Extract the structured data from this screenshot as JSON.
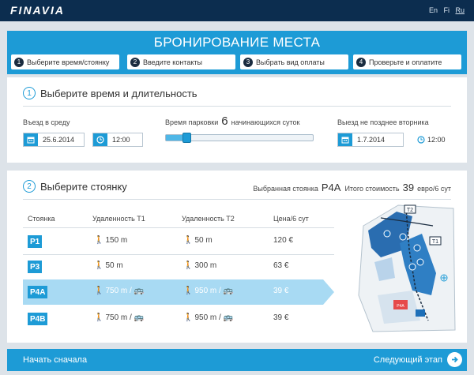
{
  "header": {
    "logo": "FINAVIA",
    "languages": [
      "En",
      "Fi",
      "Ru"
    ],
    "active_language": "Ru"
  },
  "booking": {
    "title": "БРОНИРОВАНИЕ МЕСТА",
    "steps": [
      {
        "num": "1",
        "label": "Выберите время/стоянку"
      },
      {
        "num": "2",
        "label": "Введите контакты"
      },
      {
        "num": "3",
        "label": "Выбрать вид оплаты"
      },
      {
        "num": "4",
        "label": "Проверьте и оплатите"
      }
    ]
  },
  "time_section": {
    "num": "1",
    "title": "Выберите время и длительность",
    "entry_label": "Въезд в среду",
    "entry_date": "25.6.2014",
    "entry_time": "12:00",
    "duration_prefix": "Время парковки",
    "duration_value": "6",
    "duration_suffix": "начинающихся суток",
    "duration_fraction": 0.14,
    "exit_label": "Выезд не позднее вторника",
    "exit_date": "1.7.2014",
    "exit_time": "12:00"
  },
  "parking_section": {
    "num": "2",
    "title": "Выберите стоянку",
    "selected_label": "Выбранная стоянка",
    "selected_code": "P4A",
    "total_label": "Итого стоимость",
    "total_value": "39",
    "total_unit": "евро/6 сут",
    "columns": [
      "Стоянка",
      "Удаленность Т1",
      "Удаленность Т2",
      "Цена/6 сут"
    ],
    "rows": [
      {
        "code": "P1",
        "t1": "150 m",
        "t2": "50 m",
        "price": "120 €",
        "bus": false,
        "selected": false
      },
      {
        "code": "P3",
        "t1": "50 m",
        "t2": "300 m",
        "price": "63 €",
        "bus": false,
        "selected": false
      },
      {
        "code": "P4A",
        "t1": "750 m /",
        "t2": "950 m /",
        "price": "39 €",
        "bus": true,
        "selected": true
      },
      {
        "code": "P4B",
        "t1": "750 m /",
        "t2": "950 m /",
        "price": "39 €",
        "bus": true,
        "selected": false
      }
    ],
    "map": {
      "terminal_labels": [
        "T2",
        "T1"
      ],
      "selected_marker": "P4A"
    }
  },
  "footer": {
    "restart_label": "Начать сначала",
    "next_label": "Следующий этап"
  },
  "colors": {
    "navy": "#0c2d4f",
    "accent": "#1d9bd6",
    "selected_row": "#a8daf3",
    "selected_marker": "#e64a4a"
  }
}
